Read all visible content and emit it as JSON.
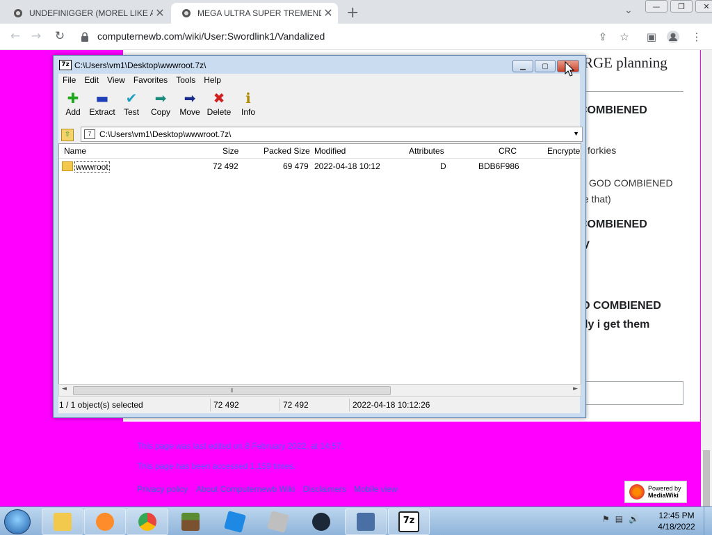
{
  "browser": {
    "tabs": [
      {
        "title": "UNDEFINIGGER (MOREL LIKE AU",
        "active": false
      },
      {
        "title": "MEGA ULTRA SUPER TREMENDO",
        "active": true
      }
    ],
    "new_tab": "+",
    "tab_search": "⌄",
    "window_controls": [
      "—",
      "❐",
      "✕"
    ],
    "url": "computernewb.com/wiki/User:Swordlink1/Vandalized"
  },
  "page": {
    "heading_fragment": "RGE planning",
    "lines": [
      "COMBIENED",
      "forkies",
      "GOD COMBIENED",
      "e that)",
      "COMBIENED",
      "y",
      "D COMBIENED",
      "ly i get them"
    ],
    "footer": {
      "last_edited": "This page was last edited on 8 February 2022, at 14:57.",
      "accessed": "This page has been accessed 1,159 times.",
      "links": [
        "Privacy policy",
        "About Computernewb Wiki",
        "Disclaimers",
        "Mobile view"
      ],
      "badge_line1": "Powered by",
      "badge_line2": "MediaWiki"
    }
  },
  "sevenzip": {
    "title": "C:\\Users\\vm1\\Desktop\\wwwroot.7z\\",
    "app_icon": "7z",
    "menu": [
      "File",
      "Edit",
      "View",
      "Favorites",
      "Tools",
      "Help"
    ],
    "tools": [
      {
        "label": "Add",
        "icon": "plus-icon",
        "glyph": "✚",
        "color": "#1ea81e"
      },
      {
        "label": "Extract",
        "icon": "minus-icon",
        "glyph": "▬",
        "color": "#1f3fb8"
      },
      {
        "label": "Test",
        "icon": "check-icon",
        "glyph": "✔",
        "color": "#20a0c0"
      },
      {
        "label": "Copy",
        "icon": "copy-arrow-icon",
        "glyph": "➡",
        "color": "#1a8a7a"
      },
      {
        "label": "Move",
        "icon": "move-arrow-icon",
        "glyph": "➡",
        "color": "#1a2a8a"
      },
      {
        "label": "Delete",
        "icon": "delete-x-icon",
        "glyph": "✖",
        "color": "#d02020"
      },
      {
        "label": "Info",
        "icon": "info-icon",
        "glyph": "ℹ",
        "color": "#b08a00"
      }
    ],
    "address": "C:\\Users\\vm1\\Desktop\\wwwroot.7z\\",
    "columns": [
      "Name",
      "Size",
      "Packed Size",
      "Modified",
      "Attributes",
      "CRC",
      "Encrypte"
    ],
    "rows": [
      {
        "name": "wwwroot",
        "size": "72 492",
        "packed": "69 479",
        "modified": "2022-04-18 10:12",
        "attributes": "D",
        "crc": "BDB6F986"
      }
    ],
    "status": {
      "selected": "1 / 1 object(s) selected",
      "size": "72 492",
      "packed": "72 492",
      "modified": "2022-04-18 10:12:26"
    }
  },
  "taskbar": {
    "apps": [
      "file-explorer",
      "media-player",
      "chrome",
      "minecraft",
      "roblox",
      "roblox-studio",
      "steam",
      "image-editor",
      "7-zip"
    ],
    "app_colors": [
      "#f2c94c",
      "#ff8c2a",
      "#e8453c",
      "#5b8c32",
      "#1e88e5",
      "#bfbfbf",
      "#1b2838",
      "#4a6fa5",
      "#222222"
    ],
    "seven_zip_label": "7z",
    "clock_time": "12:45 PM",
    "clock_date": "4/18/2022"
  }
}
